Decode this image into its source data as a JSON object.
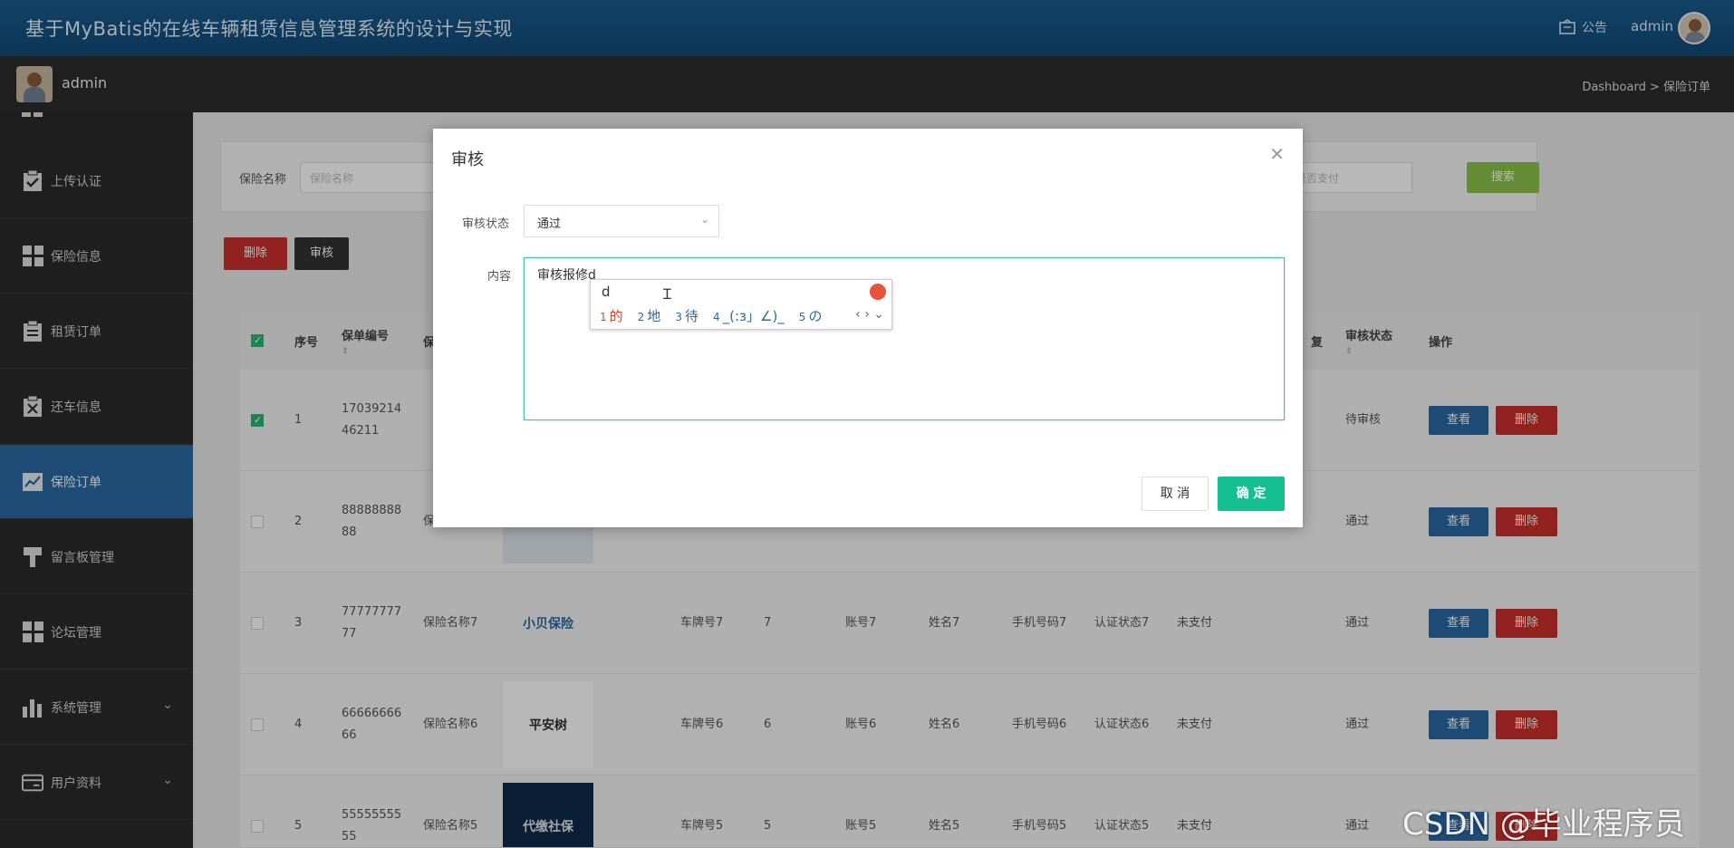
{
  "header": {
    "title": "基于MyBatis的在线车辆租赁信息管理系统的设计与实现",
    "notice_label": "公告",
    "user": "admin"
  },
  "subbar": {
    "username": "admin",
    "breadcrumb": "Dashboard > 保险订单"
  },
  "sidebar": {
    "items": [
      {
        "label": "上传认证",
        "icon": "clipboard-check-icon"
      },
      {
        "label": "保险信息",
        "icon": "grid-icon"
      },
      {
        "label": "租赁订单",
        "icon": "clipboard-list-icon"
      },
      {
        "label": "还车信息",
        "icon": "clipboard-x-icon"
      },
      {
        "label": "保险订单",
        "icon": "line-chart-icon",
        "active": true
      },
      {
        "label": "留言板管理",
        "icon": "brush-icon"
      },
      {
        "label": "论坛管理",
        "icon": "grid-icon"
      },
      {
        "label": "系统管理",
        "icon": "bar-chart-icon",
        "expandable": true
      },
      {
        "label": "用户资料",
        "icon": "card-icon",
        "expandable": true
      }
    ]
  },
  "search": {
    "label": "保险名称",
    "placeholder": "保险名称",
    "pay_placeholder": "是否支付",
    "button": "搜索"
  },
  "toolbar": {
    "delete_label": "删除",
    "audit_label": "审核"
  },
  "table": {
    "headers": {
      "index": "序号",
      "policy_no": "保单编号",
      "insurance_partial": "保",
      "review_partial": "复",
      "audit_status": "审核状态",
      "actions": "操作"
    },
    "rows": [
      {
        "index": "1",
        "policy_no": "1703921446211",
        "name": "",
        "plate": "",
        "num": "",
        "account": "",
        "person": "",
        "phone": "",
        "auth": "",
        "pay": "",
        "status": "待审核",
        "checked": true
      },
      {
        "index": "2",
        "policy_no": "8888888888",
        "name": "保",
        "plate": "",
        "num": "",
        "account": "",
        "person": "",
        "phone": "",
        "auth": "",
        "pay": "",
        "status": "通过",
        "checked": false
      },
      {
        "index": "3",
        "policy_no": "7777777777",
        "name": "保险名称7",
        "logo": "小贝保险",
        "plate": "车牌号7",
        "num": "7",
        "account": "账号7",
        "person": "姓名7",
        "phone": "手机号码7",
        "auth": "认证状态7",
        "pay": "未支付",
        "status": "通过",
        "checked": false
      },
      {
        "index": "4",
        "policy_no": "6666666666",
        "name": "保险名称6",
        "logo": "平安树",
        "plate": "车牌号6",
        "num": "6",
        "account": "账号6",
        "person": "姓名6",
        "phone": "手机号码6",
        "auth": "认证状态6",
        "pay": "未支付",
        "status": "通过",
        "checked": false
      },
      {
        "index": "5",
        "policy_no": "5555555555",
        "name": "保险名称5",
        "logo": "代缴社保",
        "plate": "车牌号5",
        "num": "5",
        "account": "账号5",
        "person": "姓名5",
        "phone": "手机号码5",
        "auth": "认证状态5",
        "pay": "未支付",
        "status": "通过",
        "checked": false
      }
    ],
    "view_label": "查看",
    "delete_label": "删除"
  },
  "dialog": {
    "title": "审核",
    "status_label": "审核状态",
    "status_value": "通过",
    "content_label": "内容",
    "content_value": "审核报修d",
    "cancel": "取 消",
    "confirm": "确 定"
  },
  "ime": {
    "pinyin": "d",
    "candidates": [
      "的",
      "地",
      "待",
      "_(:з」∠)_",
      "の"
    ]
  },
  "watermark": "CSDN @毕业程序员"
}
